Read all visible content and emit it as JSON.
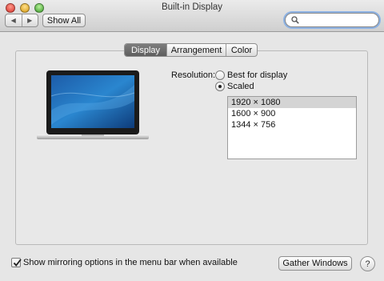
{
  "window": {
    "title": "Built-in Display"
  },
  "toolbar": {
    "back_glyph": "◀",
    "forward_glyph": "▶",
    "show_all_label": "Show All",
    "search": {
      "value": "",
      "placeholder": ""
    }
  },
  "tabs": [
    {
      "label": "Display",
      "selected": true
    },
    {
      "label": "Arrangement",
      "selected": false
    },
    {
      "label": "Color",
      "selected": false
    }
  ],
  "display": {
    "resolution_label": "Resolution:",
    "options": [
      {
        "label": "Best for display",
        "selected": false
      },
      {
        "label": "Scaled",
        "selected": true
      }
    ],
    "resolutions": [
      {
        "label": "1920 × 1080",
        "selected": true
      },
      {
        "label": "1600 × 900",
        "selected": false
      },
      {
        "label": "1344 × 756",
        "selected": false
      }
    ]
  },
  "footer": {
    "mirroring_label": "Show mirroring options in the menu bar when available",
    "mirroring_checked": true,
    "gather_label": "Gather Windows",
    "help_glyph": "?"
  },
  "colors": {
    "accent": "#5f5f5f",
    "focus_ring": "#8db2e3"
  }
}
